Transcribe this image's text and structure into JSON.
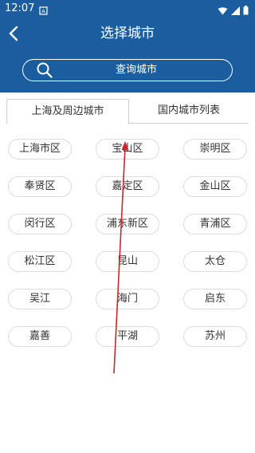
{
  "status_bar": {
    "time": "12:07"
  },
  "header": {
    "title": "选择城市"
  },
  "search": {
    "label": "查询城市"
  },
  "tabs": [
    {
      "label": "上海及周边城市",
      "selected": true
    },
    {
      "label": "国内城市列表",
      "selected": false
    }
  ],
  "cities": [
    "上海市区",
    "宝山区",
    "崇明区",
    "奉贤区",
    "嘉定区",
    "金山区",
    "闵行区",
    "浦东新区",
    "青浦区",
    "松江区",
    "昆山",
    "太仓",
    "吴江",
    "海门",
    "启东",
    "嘉善",
    "平湖",
    "苏州"
  ],
  "colors": {
    "header": "#1a5ea0",
    "annotation_arrow": "#c8282d"
  }
}
